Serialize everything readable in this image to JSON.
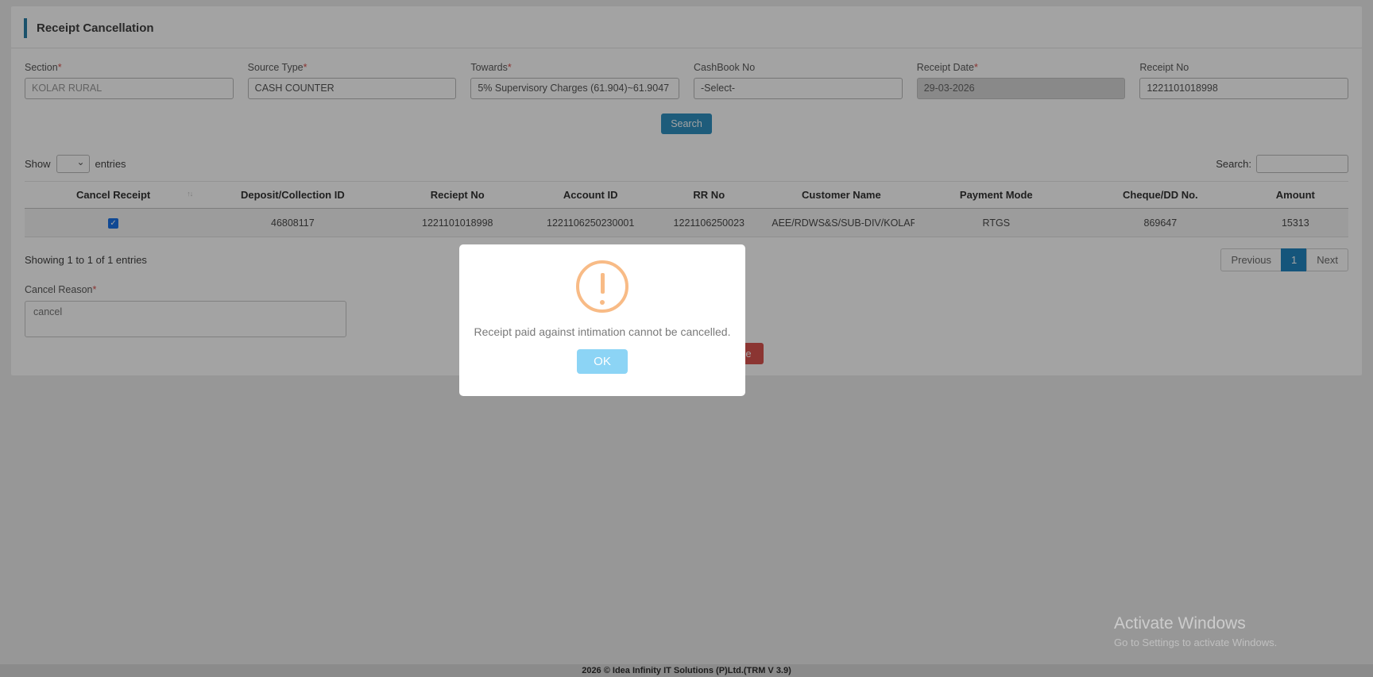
{
  "page": {
    "title": "Receipt Cancellation",
    "footer": "2026 © Idea Infinity IT Solutions (P)Ltd.(TRM V 3.9)"
  },
  "ui": {
    "required_mark": "*",
    "icons": {
      "sort": "↑↓",
      "select_chevron": "⌄",
      "checkmark": "✓"
    }
  },
  "form": {
    "fields": [
      {
        "label": "Section",
        "required": true,
        "value": "KOLAR RURAL"
      },
      {
        "label": "Source Type",
        "required": true,
        "value": "CASH COUNTER"
      },
      {
        "label": "Towards",
        "required": true,
        "value": "5% Supervisory Charges (61.904)~61.9047"
      },
      {
        "label": "CashBook No",
        "required": false,
        "value": "-Select-"
      },
      {
        "label": "Receipt Date",
        "required": true,
        "value": "29-03-2026"
      },
      {
        "label": "Receipt No",
        "required": false,
        "value": "1221101018998"
      }
    ],
    "search_button": "Search"
  },
  "datatable": {
    "show_label": "Show",
    "entries_label": "entries",
    "search_label": "Search:",
    "search_value": "",
    "columns": [
      "Cancel Receipt",
      "Deposit/Collection ID",
      "Reciept No",
      "Account ID",
      "RR No",
      "Customer Name",
      "Payment Mode",
      "Cheque/DD No.",
      "Amount"
    ],
    "row": {
      "checked": true,
      "deposit_collection_id": "46808117",
      "receipt_no": "1221101018998",
      "account_id": "1221106250230001",
      "rr_no": "1221106250023",
      "customer_name": "AEE/RDWS&S/SUB-DIV/KOLAR",
      "payment_mode": "RTGS",
      "cheque_dd_no": "869647",
      "amount": "15313"
    },
    "info": "Showing 1 to 1 of 1 entries",
    "pagination": {
      "previous": "Previous",
      "page": "1",
      "next": "Next"
    }
  },
  "cancel_reason": {
    "label": "Cancel Reason",
    "value": "cancel"
  },
  "buttons": {
    "close": "Close"
  },
  "modal": {
    "message": "Receipt paid against intimation cannot be cancelled.",
    "ok_label": "OK"
  },
  "watermark": {
    "line1": "Activate Windows",
    "line2": "Go to Settings to activate Windows."
  },
  "colors": {
    "accent_blue": "#2a7fa8",
    "button_blue": "#3090c0",
    "pagination_active": "#2186c0",
    "danger_red": "#d9534f",
    "warning_orange": "#F8BB86",
    "ok_light_blue": "#8CD4F5",
    "checkbox_blue": "#1a73e8"
  }
}
